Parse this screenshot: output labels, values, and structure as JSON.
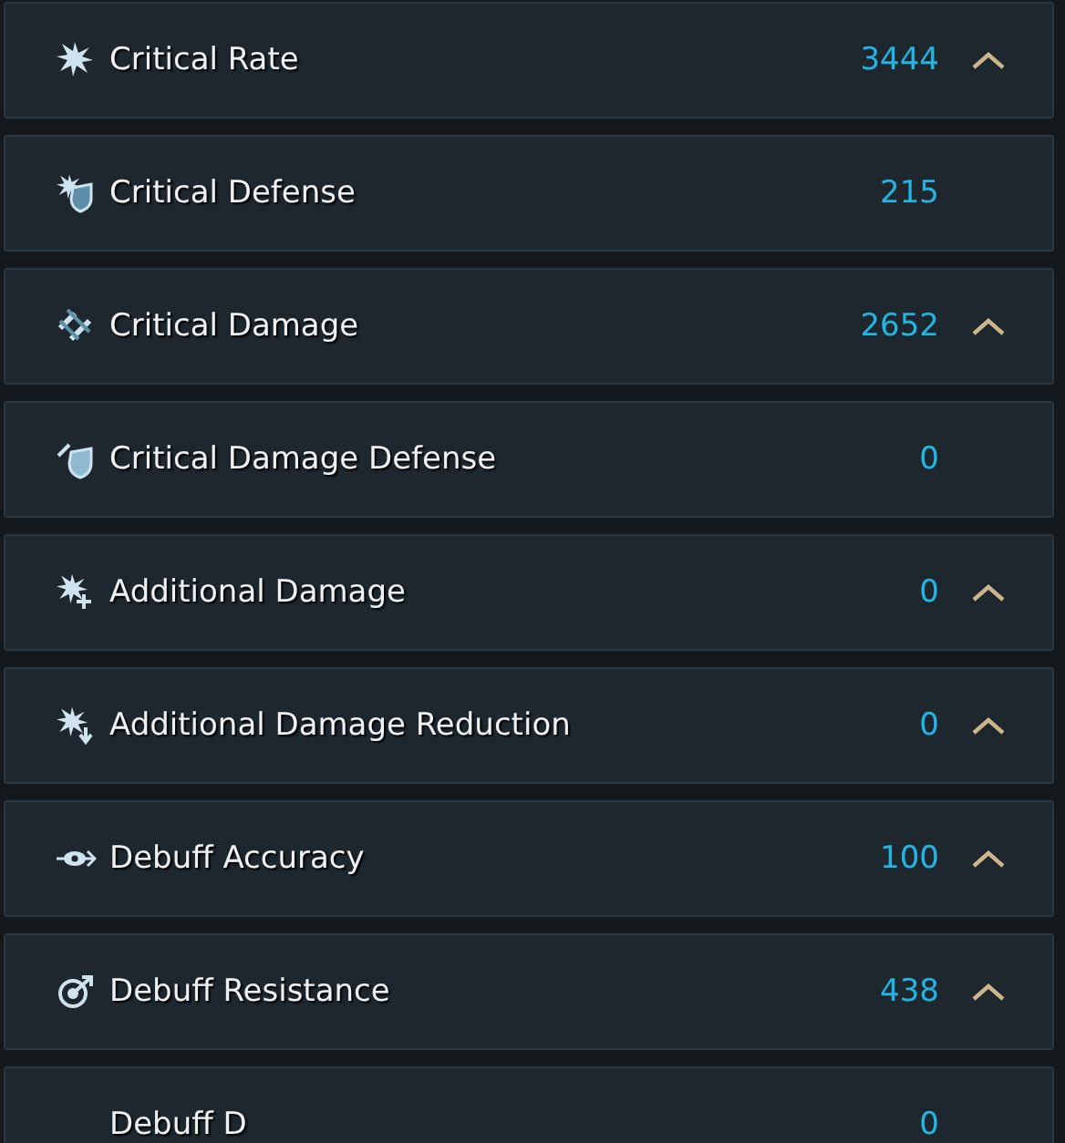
{
  "stats": [
    {
      "label": "Critical Rate",
      "value": "3444",
      "expandable": true
    },
    {
      "label": "Critical Defense",
      "value": "215",
      "expandable": false
    },
    {
      "label": "Critical Damage",
      "value": "2652",
      "expandable": true
    },
    {
      "label": "Critical Damage Defense",
      "value": "0",
      "expandable": false
    },
    {
      "label": "Additional Damage",
      "value": "0",
      "expandable": true
    },
    {
      "label": "Additional Damage Reduction",
      "value": "0",
      "expandable": true
    },
    {
      "label": "Debuff Accuracy",
      "value": "100",
      "expandable": true
    },
    {
      "label": "Debuff Resistance",
      "value": "438",
      "expandable": true
    },
    {
      "label": "Debuff D",
      "value": "0",
      "expandable": false
    }
  ]
}
